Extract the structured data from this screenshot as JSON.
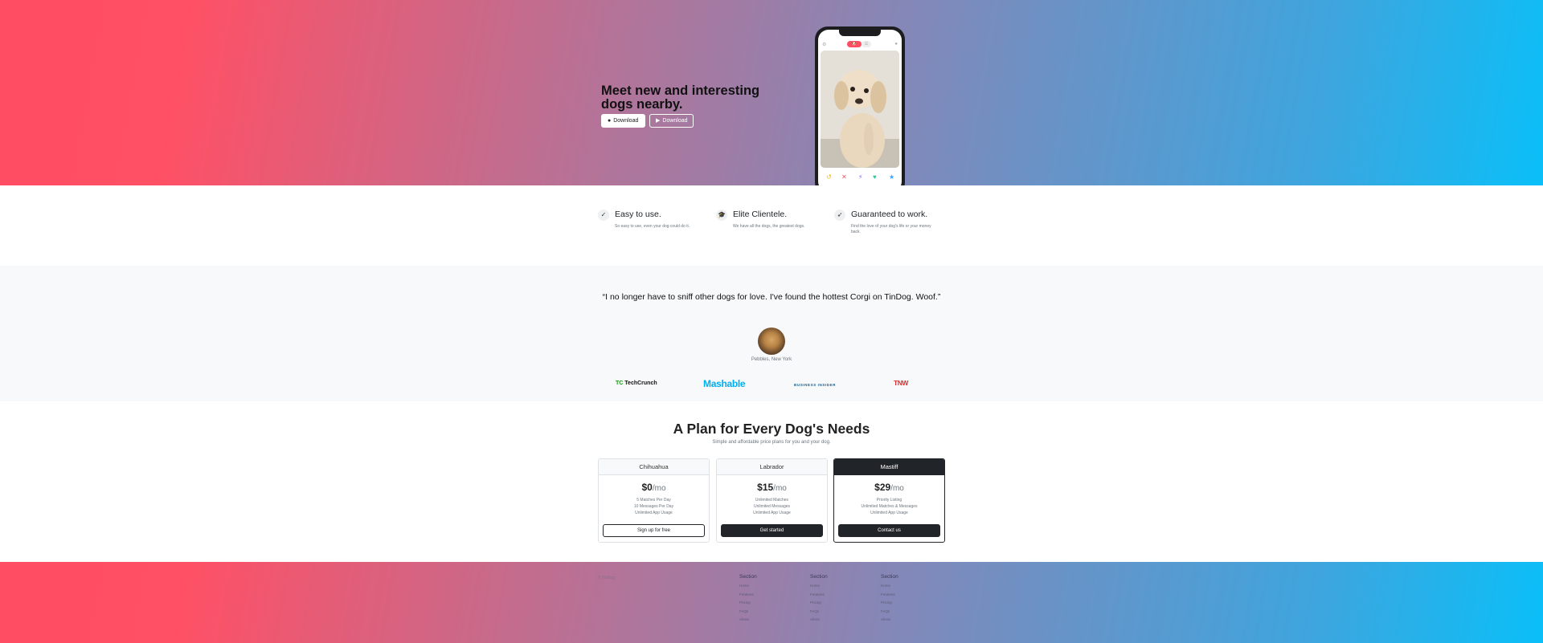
{
  "hero": {
    "title": "Meet new and interesting dogs nearby.",
    "buttons": [
      {
        "label": "Download",
        "icon": "apple-icon"
      },
      {
        "label": "Download",
        "icon": "play-store-icon"
      }
    ],
    "phone": {
      "toggle_left": "🐶",
      "toggle_right": "☰",
      "actions": [
        "↺",
        "✕",
        "⚡",
        "♥",
        "★"
      ],
      "action_colors": [
        "#f4b400",
        "#ff4d63",
        "#7b61ff",
        "#2ecc9a",
        "#3aa3ff"
      ]
    }
  },
  "features": [
    {
      "icon": "check-circle-icon",
      "glyph": "✓",
      "title": "Easy to use.",
      "desc": "So easy to use, even your dog could do it."
    },
    {
      "icon": "graduation-cap-icon",
      "glyph": "🎓",
      "title": "Elite Clientele.",
      "desc": "We have all the dogs, the greatest dogs."
    },
    {
      "icon": "heart-arrow-icon",
      "glyph": "➶",
      "title": "Guaranteed to work.",
      "desc": "Find the love of your dog's life or your money back."
    }
  ],
  "testimonial": {
    "quote": "“I no longer have to sniff other dogs for love. I've found the hottest Corgi on TinDog. Woof.”",
    "caption": "Pebbles, New York"
  },
  "press": {
    "techcrunch_tc": "TC",
    "techcrunch_name": "TechCrunch",
    "mashable": "Mashable",
    "business_insider": "BUSINESS INSIDER",
    "tnw": "TNW"
  },
  "pricing": {
    "title": "A Plan for Every Dog's Needs",
    "subtitle": "Simple and affordable price plans for you and your dog.",
    "plans": [
      {
        "name": "Chihuahua",
        "price": "$0",
        "per": "/mo",
        "features": [
          "5 Matches Per Day",
          "10 Messages Per Day",
          "Unlimited App Usage"
        ],
        "button": "Sign up for free"
      },
      {
        "name": "Labrador",
        "price": "$15",
        "per": "/mo",
        "features": [
          "Unlimited Matches",
          "Unlimited Messages",
          "Unlimited App Usage"
        ],
        "button": "Get started"
      },
      {
        "name": "Mastiff",
        "price": "$29",
        "per": "/mo",
        "features": [
          "Priority Listing",
          "Unlimited Matches & Messages",
          "Unlimited App Usage"
        ],
        "button": "Contact us"
      }
    ]
  },
  "footer": {
    "copyright": "© TinDog",
    "columns": [
      {
        "title": "Section",
        "links": [
          "Home",
          "Features",
          "Pricing",
          "FAQs",
          "About"
        ]
      },
      {
        "title": "Section",
        "links": [
          "Home",
          "Features",
          "Pricing",
          "FAQs",
          "About"
        ]
      },
      {
        "title": "Section",
        "links": [
          "Home",
          "Features",
          "Pricing",
          "FAQs",
          "About"
        ]
      }
    ]
  }
}
